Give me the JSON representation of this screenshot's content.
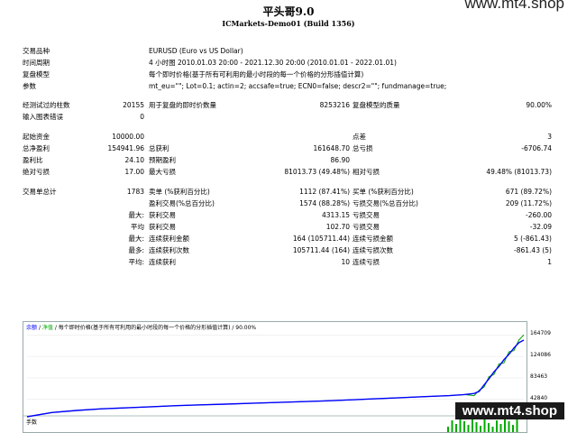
{
  "header": {
    "title": "平头哥9.0",
    "subtitle": "ICMarkets-Demo01 (Build 1356)"
  },
  "watermark": {
    "top": "www.mt4.shop",
    "bottom": "www.mt4.shop"
  },
  "info": [
    {
      "label": "交易品种",
      "value": "EURUSD (Euro vs US Dollar)"
    },
    {
      "label": "时间周期",
      "value": "4 小时图 2010.01.03 20:00 - 2021.12.30 20:00 (2010.01.01 - 2022.01.01)"
    },
    {
      "label": "复盘模型",
      "value": "每个即时价格(基于所有可利用的最小时段的每一个价格的分形插值计算)"
    },
    {
      "label": "参数",
      "value": "mt_eu=\"\"; Lot=0.1; actin=2; accsafe=true; ECN0=false; descr2=\"\"; fundmanage=true;"
    }
  ],
  "bars": {
    "label": "经测试过的柱数",
    "value": "20155",
    "ticks_label": "用于复盘的即时价数量",
    "ticks_value": "8253216",
    "quality_label": "复盘模型的质量",
    "quality_value": "90.00%",
    "errors_label": "输入图表错误",
    "errors_value": "0"
  },
  "money": {
    "deposit_label": "起始资金",
    "deposit_value": "10000.00",
    "spread_label": "点差",
    "spread_value": "3",
    "netprofit_label": "总净盈利",
    "netprofit_value": "154941.96",
    "grossprofit_label": "总获利",
    "grossprofit_value": "161648.70",
    "grossloss_label": "总亏损",
    "grossloss_value": "-6706.74",
    "pf_label": "盈利比",
    "pf_value": "24.10",
    "expected_label": "预期盈利",
    "expected_value": "86.90",
    "absdd_label": "绝对亏损",
    "absdd_value": "17.00",
    "maxdd_label": "最大亏损",
    "maxdd_value": "81013.73 (49.48%)",
    "reldd_label": "相对亏损",
    "reldd_value": "49.48% (81013.73)"
  },
  "trades": {
    "total_label": "交易单总计",
    "total_value": "1783",
    "short_label": "卖单 (%获利百分比)",
    "short_value": "1112 (87.41%)",
    "long_label": "买单 (%获利百分比)",
    "long_value": "671 (89.72%)",
    "profit_trades_label": "盈利交易(%总百分比)",
    "profit_trades_value": "1574 (88.28%)",
    "loss_trades_label": "亏损交易(%总百分比)",
    "loss_trades_value": "209 (11.72%)",
    "max_label": "最大:",
    "largest_profit_label": "获利交易",
    "largest_profit_value": "4313.15",
    "largest_loss_label": "亏损交易",
    "largest_loss_value": "-260.00",
    "avg_label": "平均",
    "avg_profit_label": "获利交易",
    "avg_profit_value": "102.70",
    "avg_loss_label": "亏损交易",
    "avg_loss_value": "-32.09",
    "max2_label": "最大:",
    "cons_wins_money_label": "连续获利金额",
    "cons_wins_money_value": "164 (105711.44)",
    "cons_loss_money_label": "连续亏损金额",
    "cons_loss_money_value": "5 (-861.43)",
    "most_label": "最多:",
    "cons_profit_count_label": "连续获利次数",
    "cons_profit_count_value": "105711.44 (164)",
    "cons_loss_count_label": "连续亏损次数",
    "cons_loss_count_value": "-861.43 (5)",
    "avg2_label": "平均:",
    "avg_cons_wins_label": "连续获利",
    "avg_cons_wins_value": "10",
    "avg_cons_loss_label": "连续亏损",
    "avg_cons_loss_value": "1"
  },
  "chart_caption": {
    "balance": "余额",
    "equity": "净值",
    "rest": "/ 每个即时价格(基于所有可利用的最小时段的每一个价格的分形插值计算) / 90.00%"
  },
  "lot_label": "手数",
  "colors": {
    "balance": "#0000ff",
    "equity": "#00a000",
    "lot": "#00aa00"
  },
  "chart_data": {
    "type": "line",
    "yticks": [
      42840,
      83463,
      124086,
      164709
    ],
    "ylim": [
      22000,
      172000
    ],
    "x": [
      0,
      5,
      10,
      15,
      20,
      25,
      30,
      35,
      40,
      45,
      50,
      55,
      60,
      65,
      70,
      75,
      80,
      85,
      88,
      90,
      91,
      92,
      93,
      94,
      95,
      96,
      97,
      98,
      99,
      100
    ],
    "series": [
      {
        "name": "余额",
        "values": [
          10000,
          18000,
          22000,
          25000,
          27000,
          29000,
          31000,
          32500,
          34000,
          35500,
          37000,
          38500,
          40000,
          42000,
          44000,
          46000,
          48000,
          50000,
          52000,
          54000,
          58000,
          70000,
          82000,
          95000,
          105000,
          118000,
          128000,
          140000,
          150000,
          155000
        ]
      },
      {
        "name": "净值",
        "values": [
          10000,
          18000,
          22000,
          25000,
          27000,
          29000,
          31000,
          32500,
          34000,
          35500,
          37000,
          38500,
          40000,
          42000,
          44000,
          46000,
          48000,
          50000,
          52000,
          50000,
          60000,
          66000,
          86000,
          90000,
          110000,
          112000,
          133000,
          135000,
          155000,
          165000
        ]
      }
    ]
  }
}
